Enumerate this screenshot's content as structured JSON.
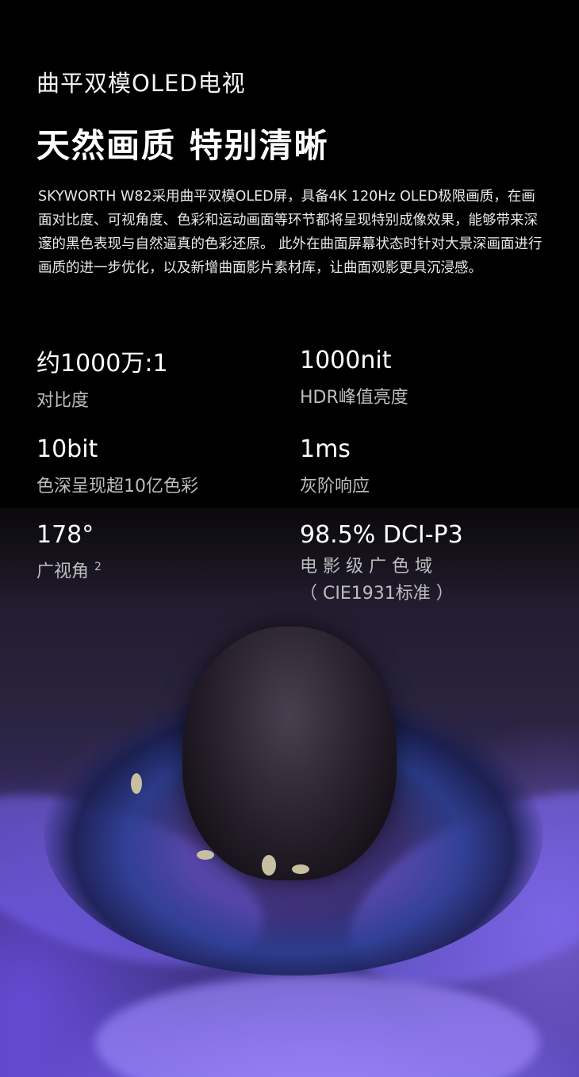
{
  "subtitle": "曲平双模OLED电视",
  "headline": "天然画质 特别清晰",
  "description": "SKYWORTH W82采用曲平双模OLED屏，具备4K 120Hz OLED极限画质，在画面对比度、可视角度、色彩和运动画面等环节都将呈现特别成像效果，能够带来深邃的黑色表现与自然逼真的色彩还原。 此外在曲面屏幕状态时针对大景深画面进行画质的进一步优化，以及新增曲面影片素材库，让曲面观影更具沉浸感。",
  "specs": [
    {
      "value": "约1000万:1",
      "label": "对比度"
    },
    {
      "value": "1000nit",
      "label": "HDR峰值亮度"
    },
    {
      "value": "10bit",
      "label": "色深呈现超10亿色彩"
    },
    {
      "value": "1ms",
      "label": "灰阶响应"
    },
    {
      "value": "178°",
      "label": "广视角",
      "superscript": "2"
    },
    {
      "value": "98.5% DCI-P3",
      "label": "电 影 级 广 色 域",
      "label_line2": "（ CIE1931标准 ）"
    }
  ],
  "colors": {
    "background": "#000000",
    "text": "#ffffff",
    "label": "#bdbdbd",
    "accent_purple": "#6a55d8"
  }
}
